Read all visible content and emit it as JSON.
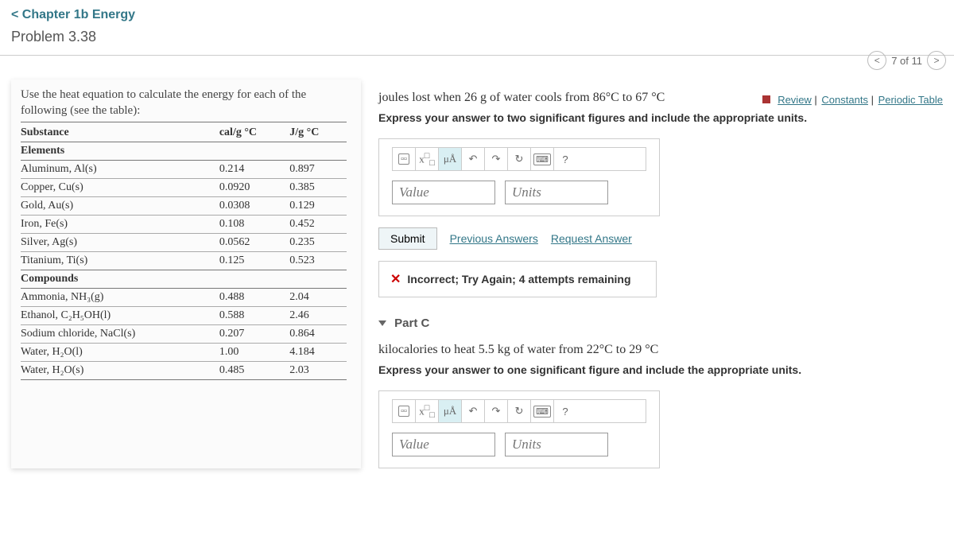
{
  "header": {
    "chapter_link": "Chapter 1b Energy",
    "problem": "Problem 3.38",
    "pager": "7 of 11",
    "review": "Review",
    "constants": "Constants",
    "periodic": "Periodic Table"
  },
  "left": {
    "instructions": "Use the heat equation to calculate the energy for each of the following (see the table):",
    "col_substance": "Substance",
    "col_cal": "cal/g °C",
    "col_j": "J/g °C",
    "section_elements": "Elements",
    "section_compounds": "Compounds",
    "rows_elements": [
      {
        "name": "Aluminum, Al(s)",
        "cal": "0.214",
        "j": "0.897"
      },
      {
        "name": "Copper, Cu(s)",
        "cal": "0.0920",
        "j": "0.385"
      },
      {
        "name": "Gold, Au(s)",
        "cal": "0.0308",
        "j": "0.129"
      },
      {
        "name": "Iron, Fe(s)",
        "cal": "0.108",
        "j": "0.452"
      },
      {
        "name": "Silver, Ag(s)",
        "cal": "0.0562",
        "j": "0.235"
      },
      {
        "name": "Titanium, Ti(s)",
        "cal": "0.125",
        "j": "0.523"
      }
    ],
    "rows_compounds": [
      {
        "name": "Ammonia, NH₃(g)",
        "cal": "0.488",
        "j": "2.04"
      },
      {
        "name": "Ethanol, C₂H₅OH(l)",
        "cal": "0.588",
        "j": "2.46"
      },
      {
        "name": "Sodium chloride, NaCl(s)",
        "cal": "0.207",
        "j": "0.864"
      },
      {
        "name": "Water, H₂O(l)",
        "cal": "1.00",
        "j": "4.184"
      },
      {
        "name": "Water, H₂O(s)",
        "cal": "0.485",
        "j": "2.03"
      }
    ]
  },
  "partB": {
    "question": "joules lost when 26 g of water cools from 86°C to 67 °C",
    "instruction": "Express your answer to two significant figures and include the appropriate units.",
    "value_ph": "Value",
    "units_ph": "Units",
    "submit": "Submit",
    "prev_answers": "Previous Answers",
    "request_answer": "Request Answer",
    "feedback": "Incorrect; Try Again; 4 attempts remaining"
  },
  "partC": {
    "label": "Part C",
    "question": "kilocalories to heat 5.5 kg of water from 22°C to 29 °C",
    "instruction": "Express your answer to one significant figure and include the appropriate units.",
    "value_ph": "Value",
    "units_ph": "Units"
  },
  "toolbar": {
    "mu": "μÅ",
    "help": "?"
  }
}
